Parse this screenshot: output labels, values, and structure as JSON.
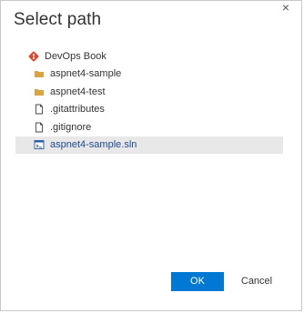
{
  "dialog": {
    "title": "Select path",
    "close_glyph": "×",
    "ok_label": "OK",
    "cancel_label": "Cancel"
  },
  "tree": {
    "root": {
      "label": "DevOps Book",
      "icon": "git-repo-icon"
    },
    "items": [
      {
        "label": "aspnet4-sample",
        "icon": "folder-icon",
        "selected": false
      },
      {
        "label": "aspnet4-test",
        "icon": "folder-icon",
        "selected": false
      },
      {
        "label": ".gitattributes",
        "icon": "file-icon",
        "selected": false
      },
      {
        "label": ".gitignore",
        "icon": "file-icon",
        "selected": false
      },
      {
        "label": "aspnet4-sample.sln",
        "icon": "solution-file-icon",
        "selected": true
      }
    ]
  },
  "colors": {
    "accent": "#0078d4",
    "git_icon": "#e0482c",
    "folder": "#d9a441",
    "selection": "#e8e8e8"
  }
}
